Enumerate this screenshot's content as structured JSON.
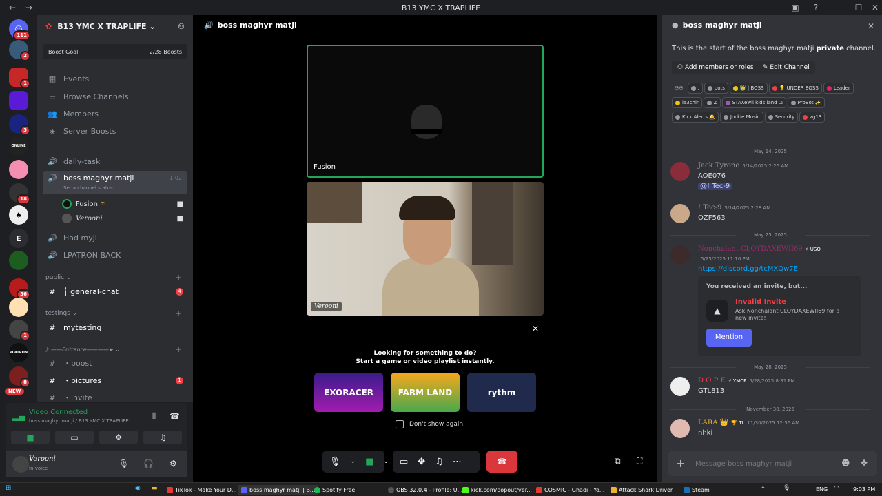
{
  "window": {
    "title": "B13 YMC X TRAPLIFE"
  },
  "guilds": [
    {
      "badge": "111"
    },
    {
      "badge": "2"
    },
    {
      "badge": "1"
    },
    {
      "badge": ""
    },
    {
      "badge": "3"
    },
    {
      "badge": ""
    },
    {
      "badge": ""
    },
    {
      "badge": "18"
    },
    {
      "badge": ""
    },
    {
      "label": "E"
    },
    {
      "badge": ""
    },
    {
      "badge": "36"
    },
    {
      "badge": ""
    },
    {
      "badge": "1"
    },
    {
      "badge": ""
    },
    {
      "badge": "8"
    }
  ],
  "guild_new": "NEW",
  "server": {
    "name": "B13 YMC X TRAPLIFE",
    "boost_goal": "Boost Goal",
    "boost_count": "2/28 Boosts"
  },
  "nav": {
    "events": "Events",
    "browse": "Browse Channels",
    "members": "Members",
    "boosts": "Server Boosts"
  },
  "channels": {
    "daily": "daily-task",
    "voice_active": "boss maghyr matji",
    "voice_time": "1:02",
    "status": "Set a channel status",
    "user1": "Fusion",
    "user1_tag": "TL",
    "user2": "Verooni",
    "had": "Had myji",
    "lpatron": "LPATRON BACK",
    "cat_public": "public",
    "general": "┆ general-chat",
    "general_badge": "4",
    "cat_testings": "testings",
    "mytesting": "mytesting",
    "cat_entrance": "》——Entrance————➤",
    "boost": "・boost",
    "pictures": "・pictures",
    "pictures_badge": "1",
    "invite": "・invite"
  },
  "voice": {
    "status": "Video Connected",
    "sub": "boss maghyr matji / B13 YMC X TRAPLIFE"
  },
  "user": {
    "name": "Verooni",
    "status": "In voice"
  },
  "main": {
    "header": "boss maghyr matji",
    "tile1_name": "Fusion",
    "tile2_name": "Verooni",
    "looking": "Looking for something to do?",
    "start": "Start a game or video playlist instantly.",
    "act1": "EXORACER",
    "act2": "FARM LAND",
    "act3": "rythm",
    "dont_show": "Don't show again"
  },
  "side": {
    "header": "boss maghyr matji",
    "intro_pre": "This is the start of the boss maghyr matji ",
    "intro_bold": "private",
    "intro_post": " channel.",
    "add_btn": "Add members or roles",
    "edit_btn": "Edit Channel",
    "roles": [
      {
        "l": ".",
        "c": "#949ba4"
      },
      {
        "l": "bots",
        "c": "#949ba4"
      },
      {
        "l": "👑 | BOSS",
        "c": "#f1c40f"
      },
      {
        "l": "💡 UNDER BOSS",
        "c": "#f23f43"
      },
      {
        "l": "Leader",
        "c": "#e91e63"
      },
      {
        "l": "la3chir",
        "c": "#f1c40f"
      },
      {
        "l": "Z",
        "c": "#949ba4"
      },
      {
        "l": "STAXewii kids land ᗝ",
        "c": "#9b59b6"
      },
      {
        "l": "ProBot ✨",
        "c": "#949ba4"
      },
      {
        "l": "Kick Alerts 🔔",
        "c": "#949ba4"
      },
      {
        "l": "Jockie Music",
        "c": "#949ba4"
      },
      {
        "l": "Security",
        "c": "#949ba4"
      },
      {
        "l": "zg13",
        "c": "#f23f43"
      }
    ],
    "dates": [
      "May 14, 2025",
      "May 25, 2025",
      "May 28, 2025",
      "November 30, 2025"
    ],
    "msgs": [
      {
        "name": "Jack Tyrone",
        "time": "5/14/2025 2:26 AM",
        "body": "AOE076",
        "mention": "@! Tec-9",
        "color": "#949ba4"
      },
      {
        "name": "! Tec-9",
        "time": "5/14/2025 2:28 AM",
        "body": "OZF563",
        "color": "#949ba4"
      },
      {
        "name": "Nonchalant CLOYDAXEWII69",
        "tag": "⚡ USO",
        "time": "5/25/2025 11:16 PM",
        "body": "https://discord.gg/tcMXQw7E",
        "color": "#9b2d6b"
      },
      {
        "name": "D O P E",
        "tag": "⚡ YMCP",
        "time": "5/28/2025 8:31 PM",
        "body": "GTL813",
        "color": "#f23f43"
      },
      {
        "name": "LARA 👑",
        "tag": "🏆 TL",
        "time": "11/30/2025 12:56 AM",
        "body": "nhki",
        "color": "#f0b232"
      }
    ],
    "invite": {
      "heading": "You received an invite, but...",
      "title": "Invalid Invite",
      "desc": "Ask Nonchalant CLOYDAXEWII69 for a new invite!",
      "button": "Mention"
    },
    "input_placeholder": "Message boss maghyr matji"
  },
  "taskbar": {
    "items": [
      "TikTok - Make Your D...",
      "boss maghyr matji | B...",
      "Spotify Free",
      "OBS 32.0.4 - Profile: U...",
      "kick.com/popout/ver...",
      "COSMIC - Ghadi - Yo...",
      "Attack Shark Driver",
      "Steam"
    ],
    "lang": "ENG",
    "time": "9:03 PM"
  }
}
